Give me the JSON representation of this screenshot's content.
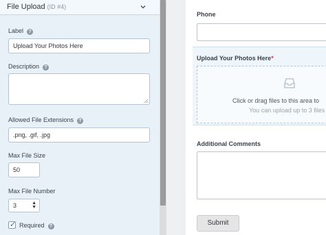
{
  "settings_panel": {
    "section_title": "File Upload",
    "section_id": "(ID #4)",
    "label_field": {
      "label": "Label",
      "value": "Upload Your Photos Here"
    },
    "description_field": {
      "label": "Description",
      "value": ""
    },
    "extensions_field": {
      "label": "Allowed File Extensions",
      "value": ".png, .gif, .jpg"
    },
    "max_size_field": {
      "label": "Max File Size",
      "value": "50"
    },
    "max_number_field": {
      "label": "Max File Number",
      "value": "3"
    },
    "required_checkbox": {
      "label": "Required",
      "checked": true
    },
    "help_glyph": "?"
  },
  "form_preview": {
    "phone_label": "Phone",
    "upload_label": "Upload Your Photos Here",
    "required_marker": "*",
    "drop_text": "Click or drag files to this area to",
    "drop_subtext": "You can upload up to 3 files",
    "comments_label": "Additional Comments",
    "submit_label": "Submit"
  },
  "icons": {
    "collapse": "chevron-down-icon",
    "help": "help-icon",
    "upload": "inbox-upload-icon",
    "check": "check-icon"
  },
  "colors": {
    "panel_bg": "#e8f1f8",
    "upload_highlight": "#eef6fc",
    "required_star": "#d63638",
    "check": "#1e6fb8"
  }
}
